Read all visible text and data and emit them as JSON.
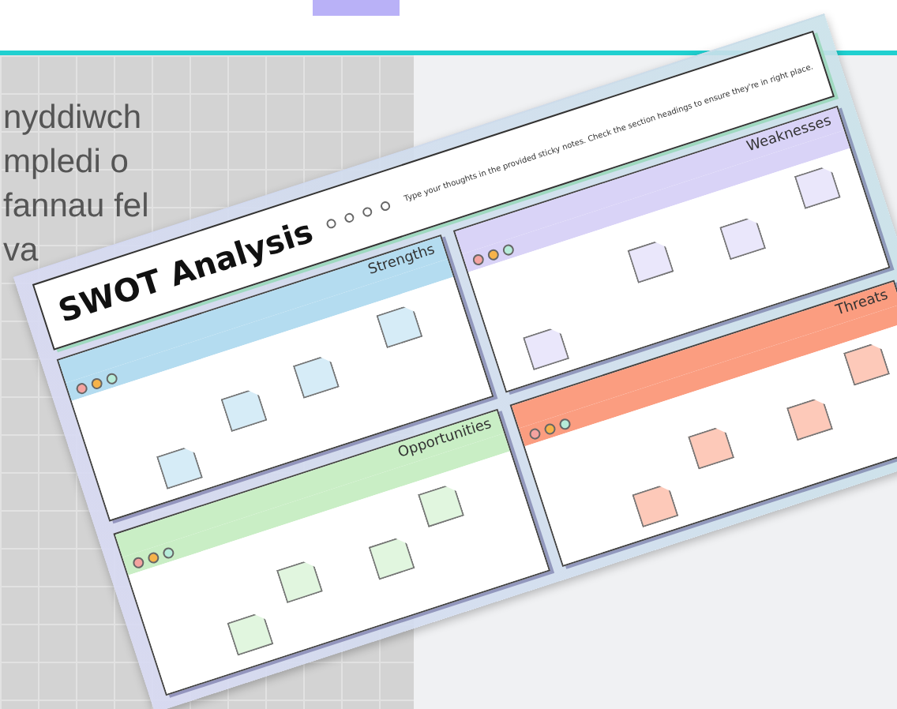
{
  "page": {
    "intro_lines": [
      "nyddiwch",
      "mpledi o",
      "fannau fel",
      "va"
    ]
  },
  "template": {
    "title": "SWOT Analysis",
    "instructions": "Type your thoughts in the provided sticky notes. Check the section headings to ensure they're in right place.",
    "quadrants": [
      {
        "label": "Strengths",
        "color": "#b4dcf0"
      },
      {
        "label": "Weaknesses",
        "color": "#d9d3f7"
      },
      {
        "label": "Opportunities",
        "color": "#c9eec5"
      },
      {
        "label": "Threats",
        "color": "#fb9d80"
      }
    ]
  }
}
